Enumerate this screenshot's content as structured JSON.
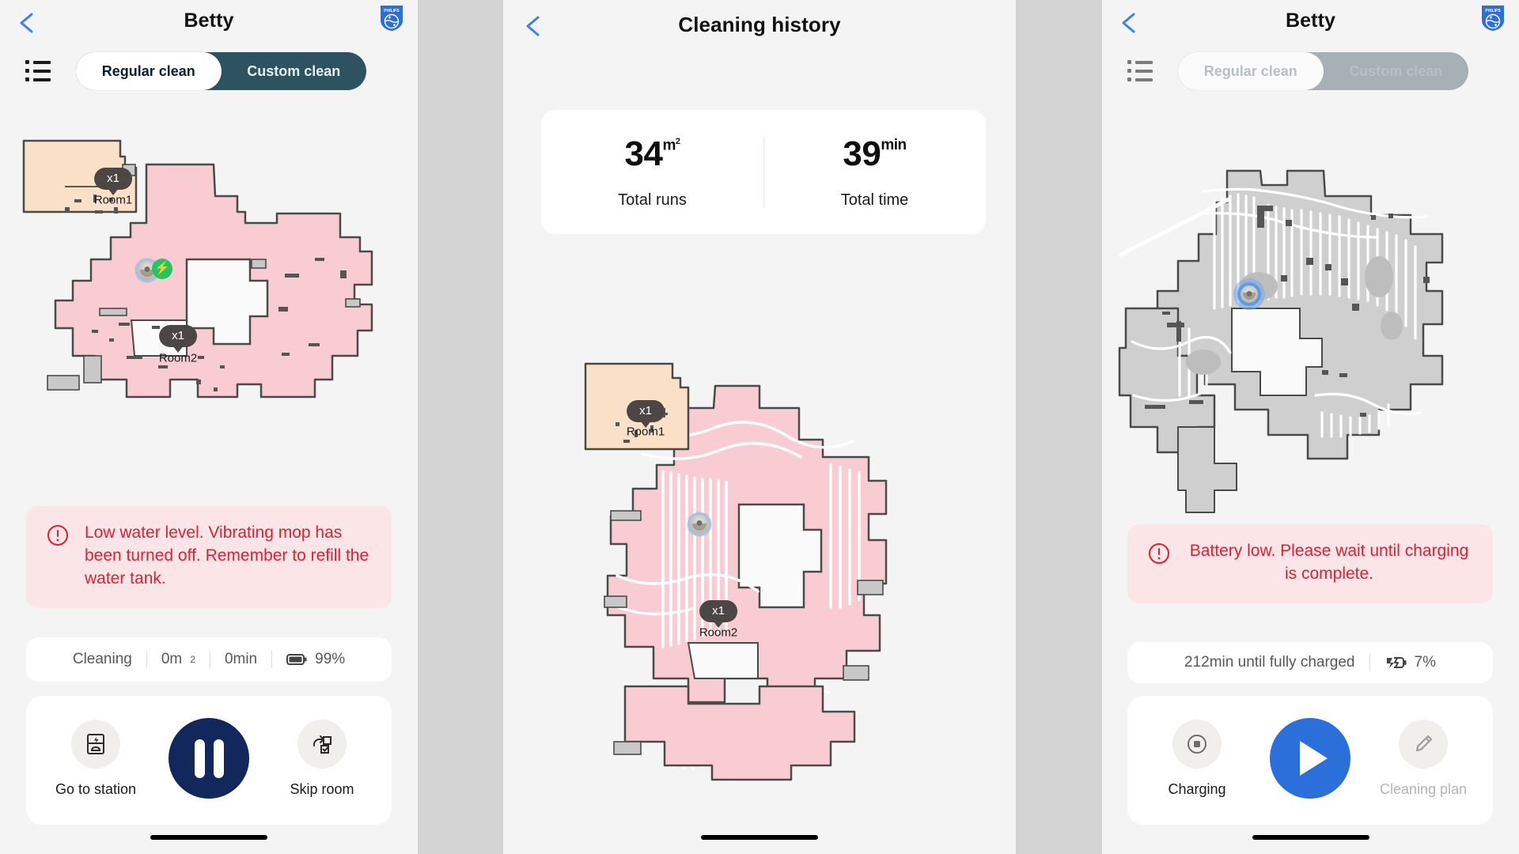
{
  "brand": {
    "logo_text": "PHILIPS"
  },
  "panel1": {
    "header": {
      "title": "Betty",
      "back_icon": "chevron-left-icon",
      "logo_icon": "philips-logo-icon"
    },
    "list_icon": "list-icon",
    "segmented": {
      "active": "Regular clean",
      "inactive": "Custom clean",
      "selected": "Regular clean",
      "disabled": false
    },
    "map": {
      "rooms": [
        {
          "name": "Room1",
          "count": "x1",
          "fill": "#fae0c7"
        },
        {
          "name": "Room2",
          "count": "x1",
          "fill": "#f9ccd3"
        }
      ],
      "robot_icon": "robot-vacuum-icon",
      "charging_badge_icon": "lightning-bolt-icon"
    },
    "alert": {
      "icon": "alert-circle-icon",
      "text": "Low water level. Vibrating mop has been turned off. Remember to refill the water tank."
    },
    "status": {
      "state": "Cleaning",
      "area": "0m",
      "area_unit": "2",
      "time": "0min",
      "battery_icon": "battery-icon",
      "battery": "99%"
    },
    "controls": {
      "left": {
        "label": "Go to station",
        "icon": "dock-station-icon"
      },
      "main": {
        "label": "pause",
        "icon": "pause-icon"
      },
      "right": {
        "label": "Skip room",
        "icon": "skip-room-icon"
      }
    }
  },
  "panel2": {
    "header": {
      "title": "Cleaning history",
      "back_icon": "chevron-left-icon"
    },
    "stats": [
      {
        "value": "34",
        "unit": "m",
        "unit_sup": "2",
        "caption": "Total runs"
      },
      {
        "value": "39",
        "unit": "min",
        "caption": "Total time"
      }
    ],
    "map": {
      "rooms": [
        {
          "name": "Room1",
          "count": "x1",
          "fill": "#fae0c7"
        },
        {
          "name": "Room2",
          "count": "x1",
          "fill": "#f9ccd3"
        }
      ],
      "robot_icon": "robot-vacuum-icon"
    }
  },
  "panel3": {
    "header": {
      "title": "Betty",
      "back_icon": "chevron-left-icon",
      "logo_icon": "philips-logo-icon"
    },
    "list_icon": "list-icon",
    "segmented": {
      "active": "Regular clean",
      "inactive": "Custom clean",
      "selected": "Regular clean",
      "disabled": true
    },
    "map": {
      "robot_icon": "robot-vacuum-icon"
    },
    "alert": {
      "icon": "alert-circle-icon",
      "text": "Battery low. Please wait until charging is complete."
    },
    "status": {
      "charge_text": "212min until fully charged",
      "battery_icon": "battery-charging-icon",
      "battery": "7%"
    },
    "controls": {
      "left": {
        "label": "Charging",
        "icon": "stop-circle-icon"
      },
      "main": {
        "label": "play",
        "icon": "play-icon"
      },
      "right": {
        "label": "Cleaning plan",
        "icon": "pencil-icon"
      }
    }
  },
  "colors": {
    "accent_blue": "#2b6fdb",
    "dark_navy": "#12275c",
    "alert_red": "#dc2035",
    "alert_bg": "#fbe5e7",
    "segment_dark": "#2d5361",
    "segment_disabled": "#a7b0b5",
    "cleaned_pink": "#f9ccd3",
    "room_peach": "#fae0c7",
    "uncleaned_gray": "#cfcfcf"
  }
}
